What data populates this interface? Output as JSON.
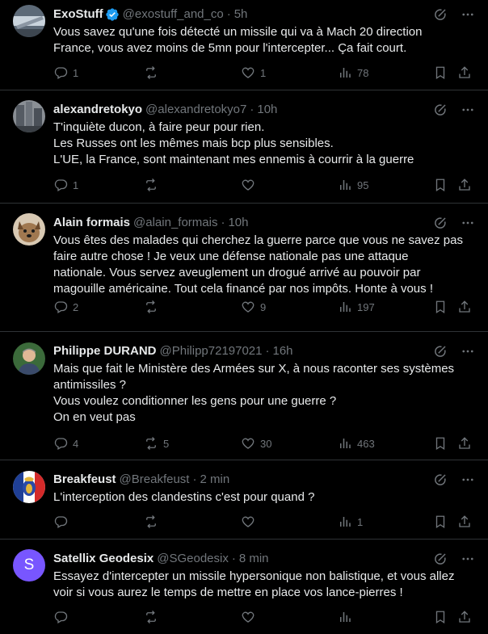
{
  "tweets": [
    {
      "name": "ExoStuff",
      "verified": true,
      "handle": "@exostuff_and_co",
      "time": "5h",
      "text": "Vous savez qu'une fois détecté un missile qui va à Mach 20 direction\nFrance, vous avez moins de 5mn pour l'intercepter... Ça fait court.",
      "replies": "1",
      "retweets": "",
      "likes": "1",
      "views": "78"
    },
    {
      "name": "alexandretokyo",
      "verified": false,
      "handle": "@alexandretokyo7",
      "time": "10h",
      "text": "T'inquiète ducon, à faire peur pour rien.\nLes Russes ont les mêmes mais bcp plus sensibles.\nL'UE, la France, sont maintenant mes ennemis à courrir à la guerre",
      "replies": "1",
      "retweets": "",
      "likes": "",
      "views": "95"
    },
    {
      "name": "Alain formais",
      "verified": false,
      "handle": "@alain_formais",
      "time": "10h",
      "text": "Vous êtes des malades qui cherchez la guerre parce que vous ne savez pas\nfaire autre chose ! Je veux une défense nationale pas une attaque\nnationale. Vous servez aveuglement un drogué arrivé au pouvoir par\nmagouille américaine. Tout cela financé par nos impôts. Honte à vous !",
      "replies": "2",
      "retweets": "",
      "likes": "9",
      "views": "197"
    },
    {
      "name": "Philippe DURAND",
      "verified": false,
      "handle": "@Philipp72197021",
      "time": "16h",
      "text": "Mais que fait le Ministère des Armées sur X, à nous raconter ses systèmes\nantimissiles ?\nVous voulez conditionner les gens pour une guerre ?\nOn en veut pas",
      "replies": "4",
      "retweets": "5",
      "likes": "30",
      "views": "463"
    },
    {
      "name": "Breakfeust",
      "verified": false,
      "handle": "@Breakfeust",
      "time": "2 min",
      "text": "L'interception des clandestins c'est pour quand ?",
      "replies": "",
      "retweets": "",
      "likes": "",
      "views": "1"
    },
    {
      "name": "Satellix Geodesix",
      "verified": false,
      "handle": "@SGeodesix",
      "time": "8 min",
      "text": "Essayez d'intercepter un missile hypersonique non balistique, et vous allez\nvoir si vous aurez le temps de mettre en place vos lance-pierres !",
      "replies": "",
      "retweets": "",
      "likes": "",
      "views": "",
      "avatar_letter": "S"
    }
  ],
  "colors": {
    "background": "#000000",
    "text": "#e7e9ea",
    "muted": "#71767b",
    "divider": "#2f3336",
    "verified": "#1d9bf0",
    "avatar_s": "#7856ff"
  },
  "icons": [
    "verified-badge-icon",
    "grok-icon",
    "more-icon",
    "reply-icon",
    "retweet-icon",
    "like-icon",
    "views-icon",
    "bookmark-icon",
    "share-icon"
  ]
}
